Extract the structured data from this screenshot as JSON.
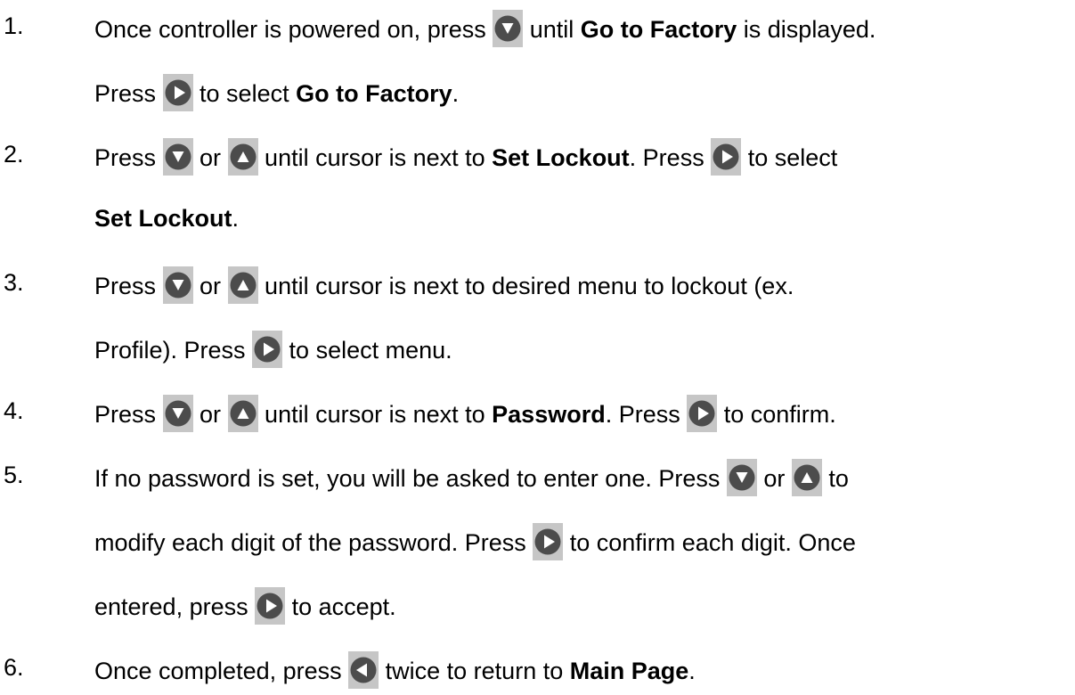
{
  "colors": {
    "button_background": "#c6c6c6",
    "button_circle": "#4c4c4c",
    "button_arrow": "#ffffff",
    "text": "#000000"
  },
  "icons": {
    "down": "down-arrow-button-icon",
    "up": "up-arrow-button-icon",
    "right": "right-arrow-button-icon",
    "left": "left-arrow-button-icon"
  },
  "steps": [
    {
      "number": "1.",
      "lines": [
        [
          "Once controller is powered on, press ",
          {
            "icon": "down"
          },
          " until ",
          {
            "b": "Go to Factory"
          },
          " is displayed."
        ],
        [
          "Press ",
          {
            "icon": "right"
          },
          " to select ",
          {
            "b": "Go to Factory"
          },
          "."
        ]
      ]
    },
    {
      "number": "2.",
      "lines": [
        [
          "Press ",
          {
            "icon": "down"
          },
          " or ",
          {
            "icon": "up"
          },
          " until cursor is next to ",
          {
            "b": "Set Lockout"
          },
          ". Press ",
          {
            "icon": "right"
          },
          " to select"
        ],
        [
          {
            "b": "Set Lockout"
          },
          "."
        ]
      ]
    },
    {
      "number": "3.",
      "lines": [
        [
          "Press ",
          {
            "icon": "down"
          },
          " or ",
          {
            "icon": "up"
          },
          " until cursor is next to desired menu to lockout (ex."
        ],
        [
          "Profile).  Press ",
          {
            "icon": "right"
          },
          " to select menu."
        ]
      ]
    },
    {
      "number": "4.",
      "lines": [
        [
          "Press ",
          {
            "icon": "down"
          },
          " or ",
          {
            "icon": "up"
          },
          " until cursor is next to ",
          {
            "b": "Password"
          },
          ".  Press ",
          {
            "icon": "right"
          },
          " to confirm."
        ]
      ]
    },
    {
      "number": "5.",
      "lines": [
        [
          "If no password is set, you will be asked to enter one.  Press ",
          {
            "icon": "down"
          },
          " or ",
          {
            "icon": "up"
          },
          " to"
        ],
        [
          "modify each digit of the password.  Press ",
          {
            "icon": "right"
          },
          " to confirm each digit.  Once"
        ],
        [
          "entered, press ",
          {
            "icon": "right"
          },
          " to accept."
        ]
      ]
    },
    {
      "number": "6.",
      "lines": [
        [
          "Once completed, press ",
          {
            "icon": "left"
          },
          " twice to return to ",
          {
            "b": "Main Page"
          },
          "."
        ]
      ]
    }
  ]
}
